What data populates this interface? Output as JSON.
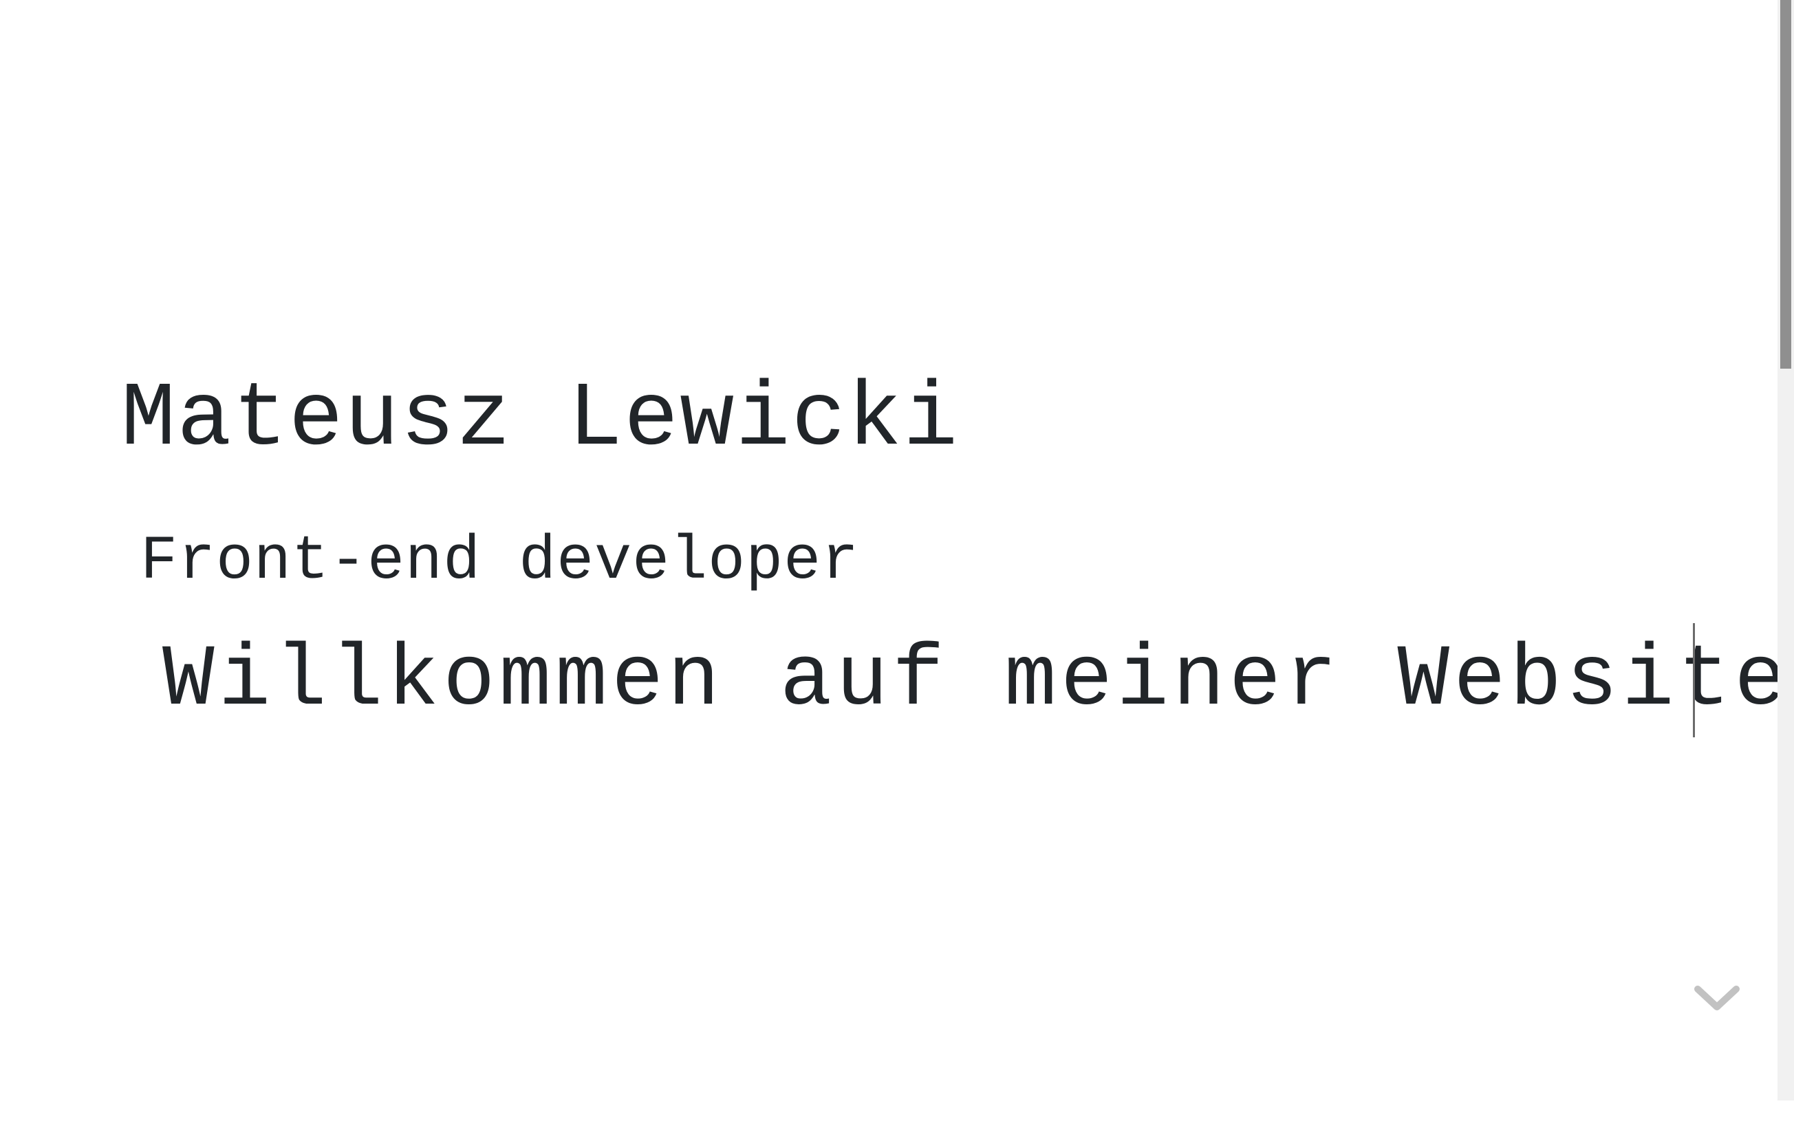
{
  "hero": {
    "name": "Mateusz Lewicki",
    "role": "Front-end developer",
    "welcome": "Willkommen auf meiner Website"
  },
  "icons": {
    "scroll_down": "chevron-down-icon"
  },
  "colors": {
    "text": "#212529",
    "background": "#ffffff",
    "chevron": "#c2c2c2",
    "scrollbar_thumb": "#8f8f8f",
    "scrollbar_track": "#f1f1f1"
  }
}
